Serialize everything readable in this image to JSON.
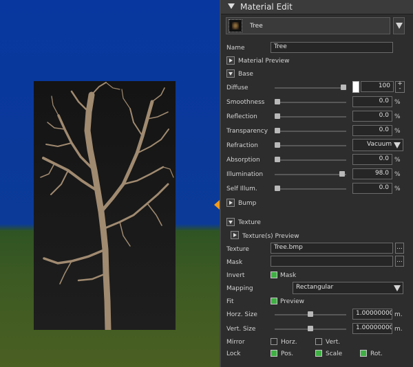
{
  "panel": {
    "title": "Material Edit",
    "material_selector": {
      "value": "Tree"
    },
    "name": {
      "label": "Name",
      "value": "Tree"
    },
    "sections": {
      "material_preview": "Material Preview",
      "base": "Base",
      "bump": "Bump",
      "texture": "Texture",
      "texture_preview": "Texture(s) Preview"
    },
    "base": {
      "diffuse": {
        "label": "Diffuse",
        "value": "100",
        "level": 1.0,
        "swatch_color": "#ffffff"
      },
      "rows": [
        {
          "label": "Smoothness",
          "value": "0.0",
          "unit": "%",
          "level": 0.0
        },
        {
          "label": "Reflection",
          "value": "0.0",
          "unit": "%",
          "level": 0.0
        },
        {
          "label": "Transparency",
          "value": "0.0",
          "unit": "%",
          "level": 0.0
        },
        {
          "label": "Refraction",
          "value": "Vacuum",
          "level": 0.0
        },
        {
          "label": "Absorption",
          "value": "0.0",
          "unit": "%",
          "level": 0.0
        },
        {
          "label": "Illumination",
          "value": "98.0",
          "unit": "%",
          "level": 0.98
        },
        {
          "label": "Self Illum.",
          "value": "0.0",
          "unit": "%",
          "level": 0.0
        }
      ]
    },
    "texture": {
      "texture_label": "Texture",
      "texture_value": "Tree.bmp",
      "mask_label": "Mask",
      "mask_value": "",
      "browse_label": "...",
      "invert_label": "Invert",
      "invert_option": "Mask",
      "invert_checked": true,
      "mapping_label": "Mapping",
      "mapping_value": "Rectangular",
      "fit_label": "Fit",
      "fit_option": "Preview",
      "fit_checked": true,
      "horz_size": {
        "label": "Horz. Size",
        "value": "1.00000000",
        "unit": "m.",
        "level": 0.5
      },
      "vert_size": {
        "label": "Vert. Size",
        "value": "1.00000000",
        "unit": "m.",
        "level": 0.5
      },
      "mirror_label": "Mirror",
      "mirror_horz": {
        "label": "Horz.",
        "checked": false
      },
      "mirror_vert": {
        "label": "Vert.",
        "checked": false
      },
      "lock_label": "Lock",
      "lock_pos": {
        "label": "Pos.",
        "checked": true
      },
      "lock_scale": {
        "label": "Scale",
        "checked": true
      },
      "lock_rot": {
        "label": "Rot.",
        "checked": true
      }
    },
    "stepper": {
      "up": "+",
      "down": "-"
    }
  },
  "colors": {
    "accent": "#f39b1a",
    "check_green": "#3fb043",
    "sky": "#0b3a98",
    "grass": "#3c5a23",
    "bark": "#a08a70"
  }
}
